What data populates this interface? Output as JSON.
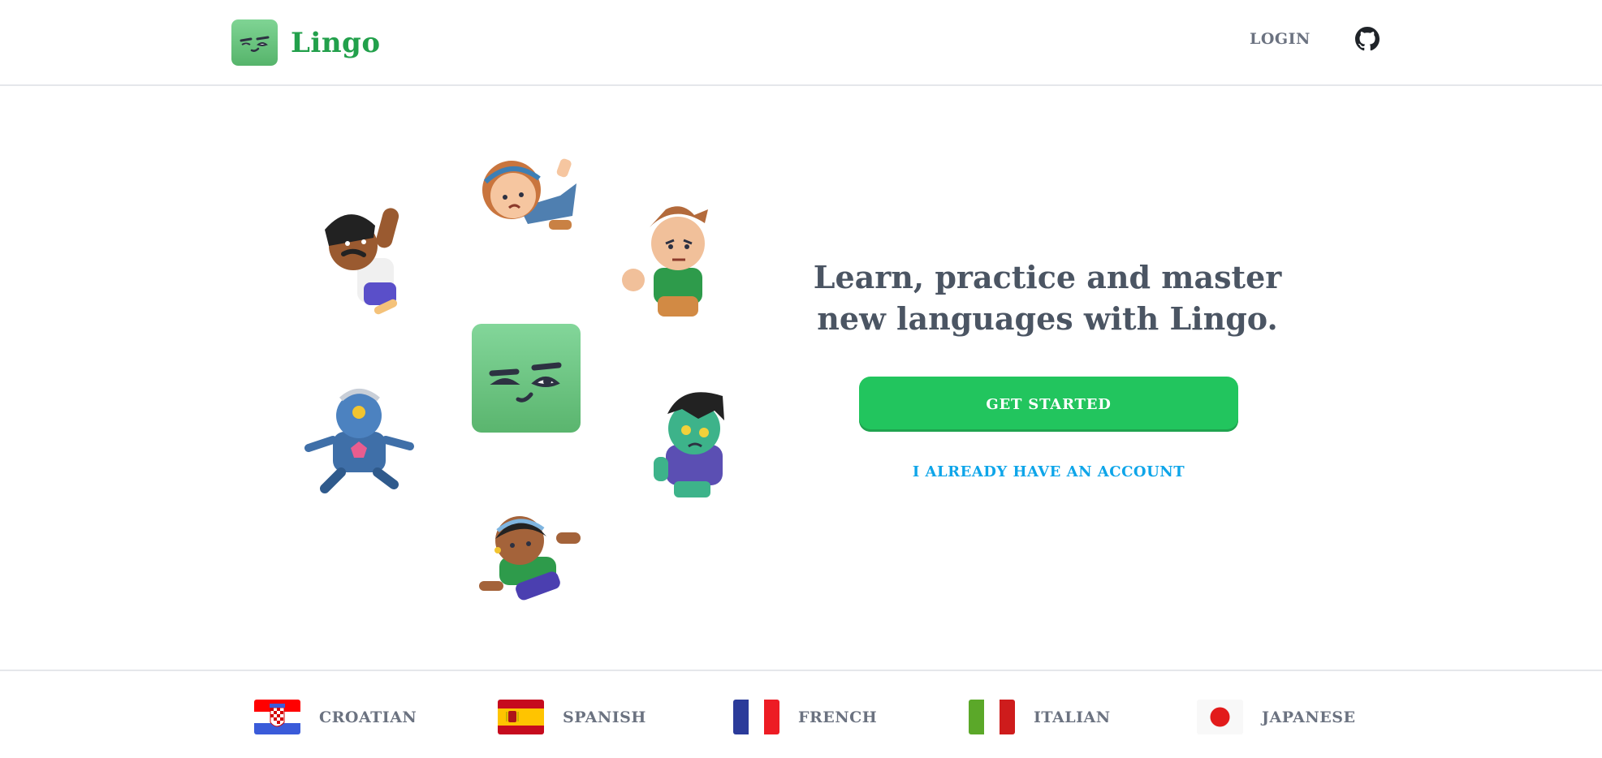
{
  "header": {
    "brand_name": "Lingo",
    "login_label": "LOGIN",
    "github_icon": "github-icon"
  },
  "hero": {
    "headline": "Learn, practice and master new languages with Lingo.",
    "get_started_label": "GET STARTED",
    "have_account_label": "I ALREADY HAVE AN ACCOUNT"
  },
  "footer": {
    "languages": [
      {
        "label": "CROATIAN",
        "flag": "croatia-flag"
      },
      {
        "label": "SPANISH",
        "flag": "spain-flag"
      },
      {
        "label": "FRENCH",
        "flag": "france-flag"
      },
      {
        "label": "ITALIAN",
        "flag": "italy-flag"
      },
      {
        "label": "JAPANESE",
        "flag": "japan-flag"
      }
    ]
  },
  "colors": {
    "brand_green": "#22a04b",
    "cta_green": "#22c55e",
    "link_blue": "#0ea5e9",
    "muted_text": "#6b7280"
  }
}
